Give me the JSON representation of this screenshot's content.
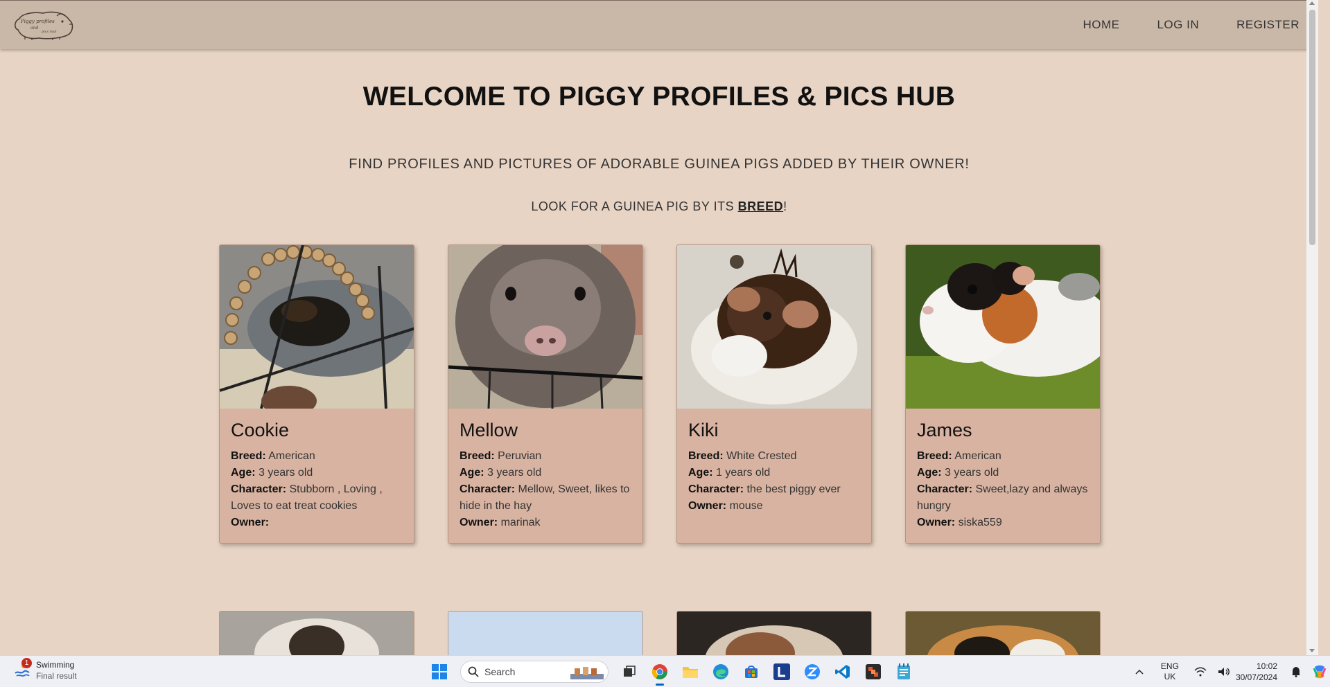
{
  "nav": {
    "logo_text": "Piggy profiles and pics hub",
    "links": [
      "HOME",
      "LOG IN",
      "REGISTER"
    ]
  },
  "hero": {
    "title": "WELCOME TO PIGGY PROFILES & PICS HUB",
    "subtitle": "FIND PROFILES AND PICTURES OF ADORABLE GUINEA PIGS ADDED BY THEIR OWNER!",
    "breed_prefix": "LOOK FOR A GUINEA PIG BY ITS ",
    "breed_link": "BREED",
    "breed_suffix": "!"
  },
  "labels": {
    "breed": "Breed:",
    "age": "Age:",
    "character": "Character:",
    "owner": "Owner:"
  },
  "cards": [
    {
      "name": "Cookie",
      "breed": "American",
      "age": "3 years old",
      "character": "Stubborn , Loving , Loves to eat treat cookies",
      "owner": ""
    },
    {
      "name": "Mellow",
      "breed": "Peruvian",
      "age": "3 years old",
      "character": "Mellow, Sweet, likes to hide in the hay",
      "owner": "marinak"
    },
    {
      "name": "Kiki",
      "breed": "White Crested",
      "age": "1 years old",
      "character": "the best piggy ever",
      "owner": "mouse"
    },
    {
      "name": "James",
      "breed": "American",
      "age": "3 years old",
      "character": "Sweet,lazy and always hungry",
      "owner": "siska559"
    }
  ],
  "colors": {
    "navbar": "#c9b8a8",
    "page_bg": "#e8d4c4",
    "card_bg": "#d8b3a1"
  },
  "taskbar": {
    "weather_title": "Swimming",
    "weather_sub": "Final result",
    "badge": "1",
    "search_placeholder": "Search",
    "lang_top": "ENG",
    "lang_bottom": "UK",
    "time": "10:02",
    "date": "30/07/2024"
  }
}
